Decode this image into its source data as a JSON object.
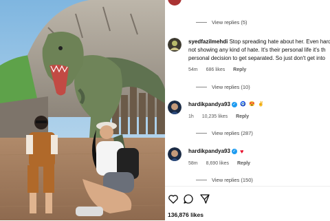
{
  "comments": [
    {
      "type": "view_replies",
      "label": "View replies (5)"
    },
    {
      "type": "comment",
      "username": "syedfazilmehdi",
      "text_lines": [
        "Stop spreading hate about her. Even hard",
        "not showing any kind of hate. It's their personal life it's th",
        "personal decision to get separated. So just don't get into"
      ],
      "time": "54m",
      "likes": "686 likes",
      "reply": "Reply",
      "view_replies": "View replies (10)"
    },
    {
      "type": "comment",
      "username": "hardikpandya93",
      "time": "1h",
      "likes": "10,235 likes",
      "reply": "Reply",
      "view_replies": "View replies (287)"
    },
    {
      "type": "comment",
      "username": "hardikpandya93",
      "time": "58m",
      "likes": "8,690 likes",
      "reply": "Reply",
      "view_replies": "View replies (150)"
    }
  ],
  "emojis_first": [
    "🧿",
    "😍",
    "✌"
  ],
  "emoji_second": "♥",
  "actions": {
    "like_icon": "heart-outline-icon",
    "comment_icon": "speech-bubble-icon",
    "share_icon": "paper-plane-icon"
  },
  "likes_total": "136,876 likes",
  "colors": {
    "verified": "#1d9bf0",
    "heart_red": "#e8112d"
  }
}
